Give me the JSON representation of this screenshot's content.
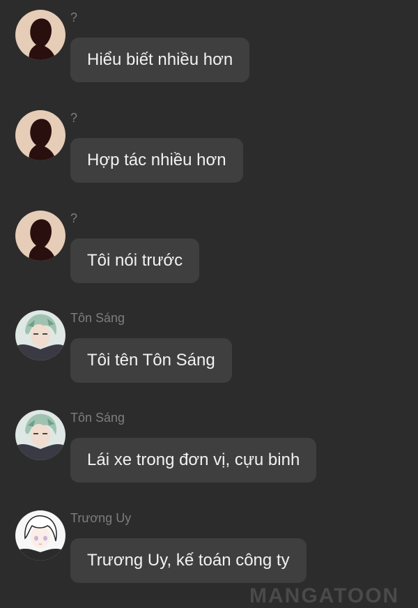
{
  "messages": [
    {
      "sender": "?",
      "text": "Hiểu biết nhiều hơn",
      "avatar": "silhouette-avatar"
    },
    {
      "sender": "?",
      "text": "Hợp tác nhiều hơn",
      "avatar": "silhouette-avatar"
    },
    {
      "sender": "?",
      "text": "Tôi nói trước",
      "avatar": "silhouette-avatar"
    },
    {
      "sender": "Tôn Sáng",
      "text": "Tôi tên Tôn Sáng",
      "avatar": "green-hair-character-avatar"
    },
    {
      "sender": "Tôn Sáng",
      "text": "Lái xe trong đơn vị, cựu binh",
      "avatar": "green-hair-character-avatar"
    },
    {
      "sender": "Trương Uy",
      "text": "Trương Uy, kế toán công ty",
      "avatar": "white-hair-character-avatar"
    }
  ],
  "watermark": "MANGATOON",
  "colors": {
    "background": "#2c2c2c",
    "bubble": "#3f3f3f",
    "text": "#f2f2f2",
    "sender": "#7d7d7d"
  }
}
